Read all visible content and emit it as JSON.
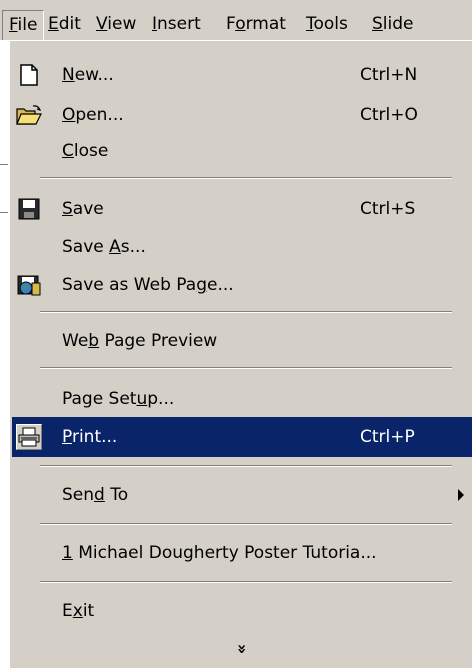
{
  "menubar": {
    "items": [
      {
        "label": "File",
        "mnemonic": "F",
        "rest": "ile"
      },
      {
        "label": "Edit",
        "mnemonic": "E",
        "rest": "dit"
      },
      {
        "label": "View",
        "mnemonic": "V",
        "rest": "iew"
      },
      {
        "label": "Insert",
        "mnemonic": "I",
        "rest": "nsert"
      },
      {
        "label": "Format",
        "pre": "F",
        "mnemonic": "o",
        "rest": "rmat"
      },
      {
        "label": "Tools",
        "mnemonic": "T",
        "rest": "ools"
      },
      {
        "label": "Slide",
        "mnemonic": "S",
        "rest": "lide"
      }
    ]
  },
  "file_menu": {
    "new": {
      "pre": "",
      "mn": "N",
      "post": "ew...",
      "shortcut": "Ctrl+N",
      "icon": "new-document-icon"
    },
    "open": {
      "pre": "",
      "mn": "O",
      "post": "pen...",
      "shortcut": "Ctrl+O",
      "icon": "open-folder-icon"
    },
    "close": {
      "pre": "",
      "mn": "C",
      "post": "lose"
    },
    "save": {
      "pre": "",
      "mn": "S",
      "post": "ave",
      "shortcut": "Ctrl+S",
      "icon": "save-disk-icon"
    },
    "save_as": {
      "pre": "Save ",
      "mn": "A",
      "post": "s..."
    },
    "save_web": {
      "pre": "Save as Web Pa",
      "mn": "g",
      "post": "e...",
      "icon": "web-page-icon"
    },
    "web_preview": {
      "pre": "We",
      "mn": "b",
      "post": " Page Preview"
    },
    "page_setup": {
      "pre": "Page Set",
      "mn": "u",
      "post": "p..."
    },
    "print": {
      "pre": "",
      "mn": "P",
      "post": "rint...",
      "shortcut": "Ctrl+P",
      "icon": "printer-icon"
    },
    "send_to": {
      "pre": "Sen",
      "mn": "d",
      "post": " To",
      "icon": "submenu-arrow-icon"
    },
    "recent1": {
      "pre": "",
      "mn": "1",
      "post": " Michael Dougherty Poster Tutoria..."
    },
    "exit": {
      "pre": "E",
      "mn": "x",
      "post": "it"
    },
    "expand": {
      "glyph": "»",
      "icon": "expand-chevron-icon"
    }
  },
  "colors": {
    "menu_bg": "#d4d0c8",
    "highlight": "#0a246a",
    "highlight_text": "#ffffff"
  }
}
